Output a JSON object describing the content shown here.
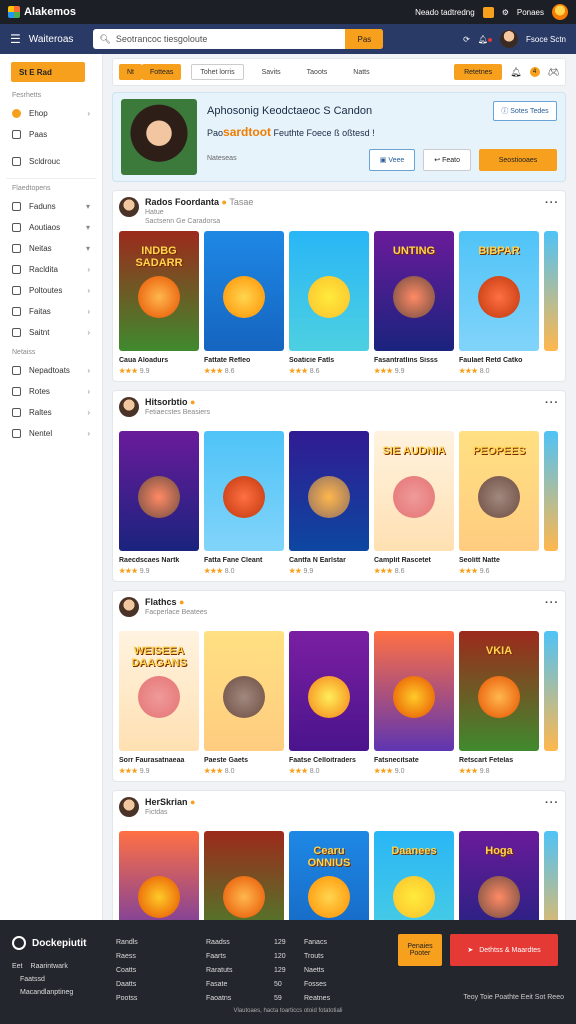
{
  "topbar": {
    "app_name": "Alakemos",
    "link1": "Neado tadtredng",
    "link2": "Ponaes"
  },
  "navbar": {
    "brand": "Waiteroas",
    "search_placeholder": "Seotrancoc tiesgoloute",
    "search_button": "Pas",
    "user_name": "Fsoce Sctn"
  },
  "sidebar": {
    "start_label": "St E Rad",
    "head1": "Fesrhetts",
    "items1": [
      {
        "label": "Ehop",
        "chev": "›"
      },
      {
        "label": "Paas",
        "chev": ""
      }
    ],
    "item_single": "Scldrouc",
    "head2": "Flaedtopens",
    "items2": [
      {
        "label": "Faduns",
        "chev": "▾"
      },
      {
        "label": "Aoutiaos",
        "chev": "▾"
      },
      {
        "label": "Neitas",
        "chev": "▾"
      },
      {
        "label": "Racldita",
        "chev": "›"
      },
      {
        "label": "Poltoutes",
        "chev": "›"
      },
      {
        "label": "Faitas",
        "chev": "›"
      },
      {
        "label": "Saitnt",
        "chev": "›"
      }
    ],
    "head3": "Netaiss",
    "items3": [
      {
        "label": "Nepadtoats",
        "chev": "›"
      },
      {
        "label": "Rotes",
        "chev": "›"
      },
      {
        "label": "Raltes",
        "chev": "›"
      },
      {
        "label": "Nentel",
        "chev": "›"
      }
    ]
  },
  "filters": {
    "chips": [
      "Nt",
      "Fotteas",
      "Tohet lorris",
      "Savits",
      "Taoots",
      "Natts"
    ],
    "right_button": "Retetnes",
    "badge": "4"
  },
  "hero": {
    "title": "Aphosonig Keodctaeoc S Candon",
    "sub_prefix": "Pao",
    "sub_highlight": "sardtoot",
    "sub_suffix": "Feuthte Foece ß oßtesd !",
    "meta": "Nateseas",
    "link": "Sotes Tedes",
    "btn1": "Veee",
    "btn2": "Feato",
    "btn3": "Seostiooaes"
  },
  "sections": [
    {
      "title": "Rados Foordanta",
      "badge": "Tasae",
      "sub1": "Hatue",
      "sub2": "Sactsenn Ge Caradorsa",
      "cards": [
        {
          "art": "INDBG SADARR",
          "title": "Caua Aloadurs",
          "stars": "★★★",
          "score": "9.9"
        },
        {
          "art": "",
          "title": "Fattate Refleo",
          "stars": "★★★",
          "score": "8.6"
        },
        {
          "art": "",
          "title": "Soaticie Fatls",
          "stars": "★★★",
          "score": "8.6"
        },
        {
          "art": "UNTING",
          "title": "Fasantratlins Sisss",
          "stars": "★★★",
          "score": "9.9"
        },
        {
          "art": "BIBPAR",
          "title": "Faulaet Retd Catko",
          "stars": "★★★",
          "score": "8.0"
        }
      ]
    },
    {
      "title": "Hitsorbtio",
      "badge": "",
      "sub1": "Fetiaecstes Beasiers",
      "sub2": "",
      "cards": [
        {
          "art": "",
          "title": "Raecdscaes Nartk",
          "stars": "★★★",
          "score": "9.9"
        },
        {
          "art": "",
          "title": "Fatta Fane Cleant",
          "stars": "★★★",
          "score": "8.0"
        },
        {
          "art": "",
          "title": "Cantfa N Earlstar",
          "stars": "★★",
          "score": "9.9"
        },
        {
          "art": "SIE AUDNIA",
          "title": "Camplit Rascetet",
          "stars": "★★★",
          "score": "8.6"
        },
        {
          "art": "PEOPEES",
          "title": "Seolitt Natte",
          "stars": "★★★",
          "score": "9.6"
        }
      ]
    },
    {
      "title": "Flathcs",
      "badge": "",
      "sub1": "Facperlace Beatees",
      "sub2": "",
      "cards": [
        {
          "art": "WEISEEA DAAGANS",
          "title": "Sorr Faurasatnaeaa",
          "stars": "★★★",
          "score": "9.9"
        },
        {
          "art": "",
          "title": "Paeste Gaets",
          "stars": "★★★",
          "score": "8.0"
        },
        {
          "art": "",
          "title": "Faatse Celloitraders",
          "stars": "★★★",
          "score": "8.0"
        },
        {
          "art": "",
          "title": "Fatsnecitsate",
          "stars": "★★★",
          "score": "9.0"
        },
        {
          "art": "VKIA",
          "title": "Retscart Fetelas",
          "stars": "★★★",
          "score": "9.8"
        }
      ]
    },
    {
      "title": "HerSkrian",
      "badge": "",
      "sub1": "Fictdas",
      "sub2": "",
      "cards": [
        {
          "art": "",
          "title": "",
          "stars": "",
          "score": ""
        },
        {
          "art": "",
          "title": "",
          "stars": "",
          "score": ""
        },
        {
          "art": "Cearu ONNIUS",
          "title": "",
          "stars": "",
          "score": ""
        },
        {
          "art": "Daanees",
          "title": "",
          "stars": "",
          "score": ""
        },
        {
          "art": "Hoga",
          "title": "",
          "stars": "",
          "score": ""
        }
      ]
    }
  ],
  "footer": {
    "brand": "Dockepiutit",
    "links": [
      [
        "Eet",
        "Raarintwark"
      ],
      [
        "",
        "Faatssd"
      ],
      [
        "",
        "Macandlanptineg"
      ]
    ],
    "col1": [
      "Randls",
      "Raess",
      "Coatts",
      "Daatts",
      "Pootss"
    ],
    "col2": [
      "Raadss",
      "Faarts",
      "Raratuts",
      "Fasate",
      "Faoatns"
    ],
    "col3": [
      "129",
      "120",
      "129",
      "50",
      "59"
    ],
    "col4": [
      "Fanacs",
      "Trouts",
      "Naetts",
      "Fosses",
      "Reatnes"
    ],
    "cta1": "Penaies Pooter",
    "cta2": "Dethtss & Maardtes",
    "bottom_right": "Teoy Toie Poathte Eeit Sot Reeo",
    "copyright": "Vlautoaes, hacta toarticcs otoid fotatotiali"
  },
  "colors": {
    "accent": "#f7a01d",
    "nav": "#2a3a66",
    "topbar": "#1d1f26",
    "footer": "#23262d",
    "cta_red": "#e53935"
  }
}
